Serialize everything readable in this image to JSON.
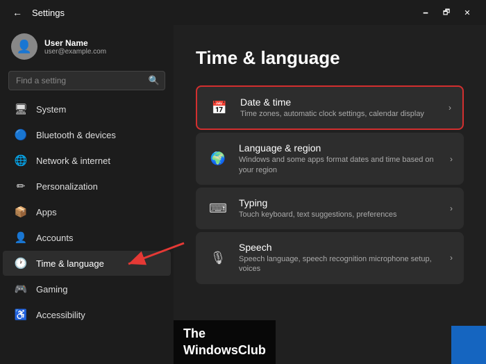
{
  "titleBar": {
    "title": "Settings",
    "backLabel": "←",
    "minimizeLabel": "🗕",
    "maximizeLabel": "🗗",
    "closeLabel": "✕"
  },
  "sidebar": {
    "user": {
      "name": "User Name",
      "email": "user@example.com"
    },
    "search": {
      "placeholder": "Find a setting"
    },
    "navItems": [
      {
        "id": "system",
        "label": "System",
        "icon": "🖥"
      },
      {
        "id": "bluetooth",
        "label": "Bluetooth & devices",
        "icon": "🔵"
      },
      {
        "id": "network",
        "label": "Network & internet",
        "icon": "🌐"
      },
      {
        "id": "personalization",
        "label": "Personalization",
        "icon": "✏"
      },
      {
        "id": "apps",
        "label": "Apps",
        "icon": "📦"
      },
      {
        "id": "accounts",
        "label": "Accounts",
        "icon": "👤"
      },
      {
        "id": "time",
        "label": "Time & language",
        "icon": "🕐",
        "active": true
      },
      {
        "id": "gaming",
        "label": "Gaming",
        "icon": "🎮"
      },
      {
        "id": "accessibility",
        "label": "Accessibility",
        "icon": "♿"
      }
    ]
  },
  "content": {
    "pageTitle": "Time & language",
    "items": [
      {
        "id": "datetime",
        "title": "Date & time",
        "subtitle": "Time zones, automatic clock settings, calendar display",
        "icon": "📅",
        "highlighted": true
      },
      {
        "id": "language",
        "title": "Language & region",
        "subtitle": "Windows and some apps format dates and time based on your region",
        "icon": "🌍",
        "highlighted": false
      },
      {
        "id": "typing",
        "title": "Typing",
        "subtitle": "Touch keyboard, text suggestions, preferences",
        "icon": "⌨",
        "highlighted": false
      },
      {
        "id": "speech",
        "title": "Speech",
        "subtitle": "Speech language, speech recognition microphone setup, voices",
        "icon": "🎙",
        "highlighted": false
      }
    ]
  },
  "watermark": {
    "line1": "The",
    "line2": "WindowsClub"
  }
}
